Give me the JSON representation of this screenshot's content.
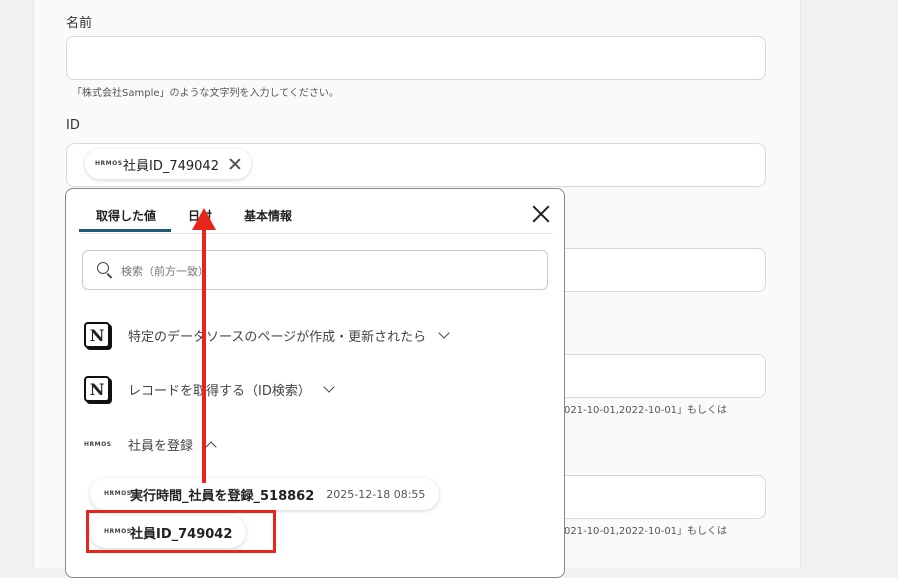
{
  "form": {
    "name_label": "名前",
    "name_hint": "「株式会社Sample」のような文字列を入力してください。",
    "id_label": "ID",
    "id_chip_text": "社員ID_749042",
    "date_hint_1": "021-10-01,2022-10-01」もしくは",
    "date_hint_2": "021-10-01,2022-10-01」もしくは"
  },
  "dropdown": {
    "tabs": [
      "取得した値",
      "日付",
      "基本情報"
    ],
    "active_tab": "取得した値",
    "search_placeholder": "検索（前方一致）",
    "groups": [
      {
        "label": "特定のデータソースのページが作成・更新されたら",
        "icon": "notion-icon",
        "expanded": false
      },
      {
        "label": "レコードを取得する（ID検索）",
        "icon": "notion-icon",
        "expanded": false
      },
      {
        "label": "社員を登録",
        "icon": "hrmos-icon",
        "expanded": true
      }
    ],
    "items": [
      {
        "label": "実行時間_社員を登録_518862",
        "time": "2025-12-18 08:55"
      },
      {
        "label": "社員ID_749042"
      }
    ]
  },
  "logos": {
    "hrmos": "HRMOS",
    "notion": "N"
  },
  "colors": {
    "accent": "#1b5c73",
    "annotation": "#e8251b"
  }
}
